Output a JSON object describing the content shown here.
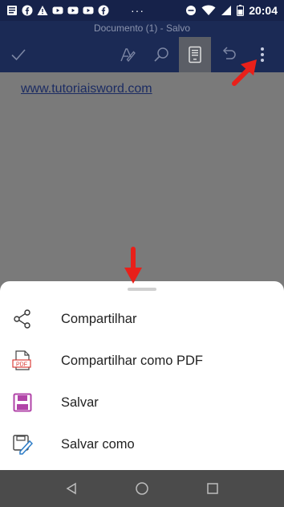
{
  "status_bar": {
    "time": "20:04",
    "dots": "···"
  },
  "title_bar": {
    "title": "Documento (1) - Salvo"
  },
  "toolbar": {
    "items": [
      {
        "name": "confirm",
        "icon": "check-icon"
      },
      {
        "name": "draw",
        "icon": "pen-a-icon"
      },
      {
        "name": "search",
        "icon": "search-icon"
      },
      {
        "name": "reading-view",
        "icon": "tablet-icon",
        "active": true
      },
      {
        "name": "undo",
        "icon": "undo-icon"
      },
      {
        "name": "more",
        "icon": "more-vertical-icon"
      }
    ]
  },
  "document": {
    "link_text": "www.tutoriaisword.com"
  },
  "menu": {
    "items": [
      {
        "label": "Compartilhar",
        "icon": "share-icon"
      },
      {
        "label": "Compartilhar como PDF",
        "icon": "pdf-file-icon",
        "icon_text": "PDF"
      },
      {
        "label": "Salvar",
        "icon": "floppy-icon"
      },
      {
        "label": "Salvar como",
        "icon": "save-as-icon"
      }
    ]
  },
  "nav_bar": {
    "items": [
      {
        "name": "back",
        "icon": "back-triangle-icon"
      },
      {
        "name": "home",
        "icon": "home-circle-icon"
      },
      {
        "name": "recents",
        "icon": "recents-square-icon"
      }
    ]
  },
  "colors": {
    "header": "#1b2a55",
    "status_bar": "#16224a",
    "annotation_arrow": "#e8201a",
    "floppy": "#b144a8",
    "pdf_red": "#d9302a"
  }
}
